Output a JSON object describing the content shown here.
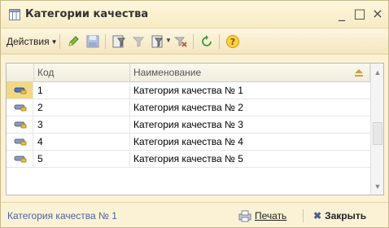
{
  "window": {
    "title": "Категории качества",
    "minimize_glyph": "_",
    "maximize_glyph": "□",
    "close_glyph": "×"
  },
  "toolbar": {
    "actions_label": "Действия",
    "icons": [
      "edit-icon",
      "save-icon",
      "filter-icon",
      "filter-disabled-icon",
      "filter-dropdown-icon",
      "clear-filter-icon",
      "refresh-icon",
      "help-icon"
    ]
  },
  "grid": {
    "columns": [
      "Код",
      "Наименование"
    ],
    "rows": [
      {
        "code": "1",
        "name": "Категория качества № 1",
        "selected": true
      },
      {
        "code": "2",
        "name": "Категория качества № 2"
      },
      {
        "code": "3",
        "name": "Категория качества № 3"
      },
      {
        "code": "4",
        "name": "Категория качества № 4"
      },
      {
        "code": "5",
        "name": "Категория качества № 5"
      }
    ]
  },
  "status": {
    "text": "Категория качества № 1",
    "print_label": "Печать",
    "close_label": "Закрыть"
  },
  "colors": {
    "accent_blue": "#4a64a0",
    "window_bg": "#fbf2d6",
    "selected_marker": "#f3d884"
  }
}
